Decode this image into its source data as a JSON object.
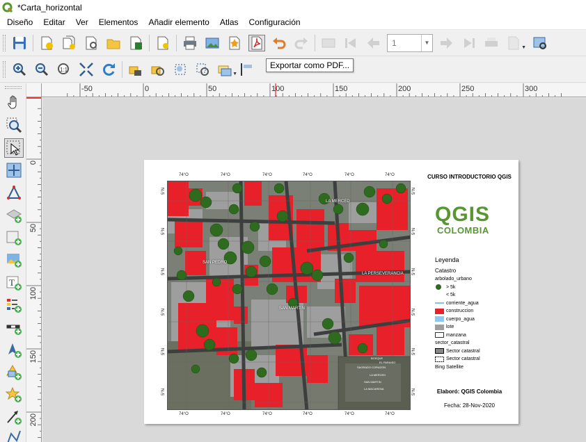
{
  "window": {
    "title": "*Carta_horizontal"
  },
  "menu": [
    {
      "label": "Diseño",
      "key": "Dis",
      "rest": "eño",
      "ul": ""
    },
    {
      "label": "Editar",
      "key": "E",
      "rest": "ditar"
    },
    {
      "label": "Ver",
      "key": "V",
      "rest": "er"
    },
    {
      "label": "Elementos",
      "key": "E",
      "rest": "lementos"
    },
    {
      "label": "Añadir elemento",
      "key": "A",
      "rest": "ñadir elemento"
    },
    {
      "label": "Atlas",
      "key": "",
      "rest": "Atlas"
    },
    {
      "label": "Configuración",
      "key": "",
      "rest": "Configuración"
    }
  ],
  "toolbar": {
    "page_number": "1",
    "tooltip": "Exportar como PDF..."
  },
  "ruler": {
    "h_labels": [
      "-50",
      "0",
      "50",
      "100",
      "150",
      "200",
      "250",
      "300"
    ],
    "v_labels": [
      "0",
      "50",
      "100",
      "150",
      "200"
    ]
  },
  "layout": {
    "title": "CURSO INTRODUCTORIO QGIS",
    "logo_main": "QGIS",
    "logo_sub": "COLOMBIA",
    "grid_label": "74°O",
    "grid_label_v": "5°N",
    "map_labels": [
      "LA MERCED",
      "SAN PEDRO",
      "LA PERSEVERANCIA",
      "SAN MARTIN"
    ],
    "inset_labels": [
      "BOSQUE",
      "EL PARAISO",
      "SAGRADO CORAZON",
      "LA MERCED",
      "SAN MARTIN",
      "LA MACARENA"
    ],
    "legend": {
      "heading": "Leyenda",
      "group": "Catastro",
      "items": [
        {
          "label": "arbolado_urbano",
          "symbol": "none"
        },
        {
          "label": "> 5k",
          "symbol": "tree"
        },
        {
          "label": "< 5k",
          "symbol": "none"
        },
        {
          "label": "corriente_agua",
          "symbol": "line"
        },
        {
          "label": "construccion",
          "symbol": "red"
        },
        {
          "label": "cuerpo_agua",
          "symbol": "lightblue"
        },
        {
          "label": "lote",
          "symbol": "gray"
        },
        {
          "label": "manzana",
          "symbol": "white"
        },
        {
          "label": "sector_catastral",
          "symbol": "none"
        },
        {
          "label": "Sector catastral",
          "symbol": "hatch"
        },
        {
          "label": "Sector catastral",
          "symbol": "dashed"
        },
        {
          "label": "Bing Satellite",
          "symbol": "none"
        }
      ]
    },
    "credit": "Elaboró: QGIS Colombia",
    "date": "Fecha: 28-Nov-2020"
  },
  "colors": {
    "construccion": "#e8202a",
    "lote": "#9e9e9e",
    "arbolado": "#2e6b1f",
    "brand": "#589632"
  }
}
